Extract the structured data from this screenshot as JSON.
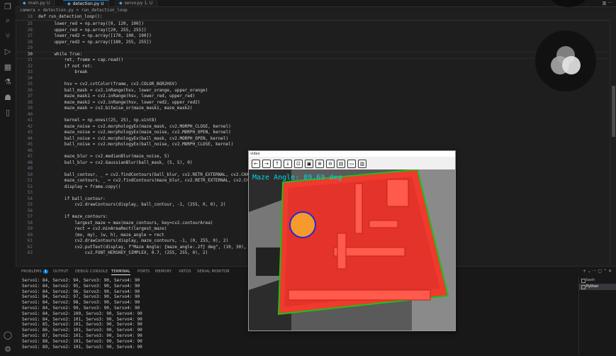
{
  "tabs": [
    {
      "label": "main.py",
      "status": "U"
    },
    {
      "label": "detection.py",
      "status": "U",
      "active": true
    },
    {
      "label": "servo.py",
      "status": "1, U"
    }
  ],
  "breadcrumb": "camera > detection.py > run_detection_loop",
  "sticky": {
    "ln": "18",
    "text": "def run_detection_loop():"
  },
  "code": [
    {
      "ln": "25",
      "text": "    lower_red = np.array([0, 120, 100])"
    },
    {
      "ln": "26",
      "text": "    upper_red = np.array([20, 255, 255])"
    },
    {
      "ln": "27",
      "text": "    lower_red2 = np.array([170, 100, 100])"
    },
    {
      "ln": "28",
      "text": "    upper_red2 = np.array([180, 255, 255])"
    },
    {
      "ln": "29",
      "text": ""
    },
    {
      "ln": "30",
      "text": "    while True:",
      "cur": true
    },
    {
      "ln": "31",
      "text": "        ret, frame = cap.read()"
    },
    {
      "ln": "32",
      "text": "        if not ret:"
    },
    {
      "ln": "33",
      "text": "            break"
    },
    {
      "ln": "34",
      "text": ""
    },
    {
      "ln": "35",
      "text": "        hsv = cv2.cvtColor(frame, cv2.COLOR_BGR2HSV)"
    },
    {
      "ln": "36",
      "text": "        ball_mask = cv2.inRange(hsv, lower_orange, upper_orange)"
    },
    {
      "ln": "37",
      "text": "        maze_mask1 = cv2.inRange(hsv, lower_red, upper_red)"
    },
    {
      "ln": "38",
      "text": "        maze_mask2 = cv2.inRange(hsv, lower_red2, upper_red2)"
    },
    {
      "ln": "39",
      "text": "        maze_mask = cv2.bitwise_or(maze_mask1, maze_mask2)"
    },
    {
      "ln": "40",
      "text": ""
    },
    {
      "ln": "41",
      "text": "        kernel = np.ones((25, 25), np.uint8)"
    },
    {
      "ln": "42",
      "text": "        maze_noise = cv2.morphologyEx(maze_mask, cv2.MORPH_CLOSE, kernel)"
    },
    {
      "ln": "43",
      "text": "        maze_noise = cv2.morphologyEx(maze_noise, cv2.MORPH_OPEN, kernel)"
    },
    {
      "ln": "44",
      "text": "        ball_noise = cv2.morphologyEx(ball_mask, cv2.MORPH_OPEN, kernel)"
    },
    {
      "ln": "45",
      "text": "        ball_noise = cv2.morphologyEx(ball_noise, cv2.MORPH_CLOSE, kernel)"
    },
    {
      "ln": "46",
      "text": ""
    },
    {
      "ln": "47",
      "text": "        maze_blur = cv2.medianBlur(maze_noise, 5)"
    },
    {
      "ln": "48",
      "text": "        ball_blur = cv2.GaussianBlur(ball_mask, (5, 5), 0)"
    },
    {
      "ln": "49",
      "text": ""
    },
    {
      "ln": "50",
      "text": "        ball_contour, _ = cv2.findContours(ball_blur, cv2.RETR_EXTERNAL, cv2.CHAIN_APPROX_SIMPLE)"
    },
    {
      "ln": "51",
      "text": "        maze_contours, _ = cv2.findContours(maze_blur, cv2.RETR_EXTERNAL, cv2.CHAIN_APPROX_SIMPLE)"
    },
    {
      "ln": "52",
      "text": "        display = frame.copy()"
    },
    {
      "ln": "53",
      "text": ""
    },
    {
      "ln": "54",
      "text": "        if ball_contour:"
    },
    {
      "ln": "55",
      "text": "            cv2.drawContours(display, ball_contour, -1, (255, 0, 0), 2)"
    },
    {
      "ln": "56",
      "text": ""
    },
    {
      "ln": "57",
      "text": "        if maze_contours:"
    },
    {
      "ln": "58",
      "text": "            largest_maze = max(maze_contours, key=cv2.contourArea)"
    },
    {
      "ln": "59",
      "text": "            rect = cv2.minAreaRect(largest_maze)"
    },
    {
      "ln": "60",
      "text": "            (mx, my), (w, h), maze_angle = rect"
    },
    {
      "ln": "61",
      "text": "            cv2.drawContours(display, maze_contours, -1, (0, 255, 0), 2)"
    },
    {
      "ln": "62",
      "text": "            cv2.putText(display, f\"Maze Angle: {maze_angle:.2f} deg\", (10, 30),"
    },
    {
      "ln": "63",
      "text": "                cv2.FONT_HERSHEY_SIMPLEX, 0.7, (255, 255, 0), 2)"
    }
  ],
  "panel": {
    "tabs": [
      "PROBLEMS",
      "OUTPUT",
      "DEBUG CONSOLE",
      "TERMINAL",
      "PORTS",
      "MEMORY",
      "XRTOS",
      "SERIAL MONITOR"
    ],
    "problems_count": "1",
    "active_tab": "TERMINAL",
    "terminal_lines": [
      "Servo1: 84, Servo2: 94, Servo3: 90, Servo4: 90",
      "Servo1: 84, Servo2: 95, Servo3: 90, Servo4: 90",
      "Servo1: 84, Servo2: 96, Servo3: 90, Servo4: 90",
      "Servo1: 84, Servo2: 97, Servo3: 90, Servo4: 90",
      "Servo1: 84, Servo2: 98, Servo3: 90, Servo4: 90",
      "Servo1: 84, Servo2: 99, Servo3: 90, Servo4: 90",
      "Servo1: 84, Servo2: 100, Servo3: 90, Servo4: 90",
      "Servo1: 84, Servo2: 101, Servo3: 90, Servo4: 90",
      "Servo1: 85, Servo2: 101, Servo3: 90, Servo4: 90",
      "Servo1: 86, Servo2: 101, Servo3: 90, Servo4: 90",
      "Servo1: 87, Servo2: 101, Servo3: 90, Servo4: 90",
      "Servo1: 88, Servo2: 101, Servo3: 90, Servo4: 90",
      "Servo1: 89, Servo2: 101, Servo3: 90, Servo4: 90"
    ],
    "terminals": [
      "bash",
      "Python"
    ]
  },
  "video": {
    "title": "video",
    "overlay_text": "Maze Angle: 89.69 deg"
  },
  "colors": {
    "accent": "#0078d4",
    "mask_red": "#f03a2e",
    "contour_green": "#19c219",
    "overlay_cyan": "#00d6e6"
  }
}
